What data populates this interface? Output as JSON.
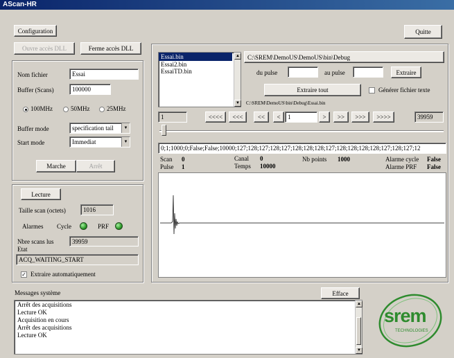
{
  "window": {
    "title": "AScan-HR"
  },
  "buttons": {
    "configuration": "Configuration",
    "quitte": "Quitte",
    "ouvre_dll": "Ouvre accès DLL",
    "ferme_dll": "Ferme accès DLL",
    "marche": "Marche",
    "arret": "Arrêt",
    "lecture": "Lecture",
    "extraire": "Extraire",
    "extraire_tout": "Extraire tout",
    "efface": "Efface",
    "nav_first": "<<<<",
    "nav_back3": "<<<",
    "nav_back2": "<<",
    "nav_back1": "<",
    "nav_fwd1": ">",
    "nav_fwd2": ">>",
    "nav_fwd3": ">>>",
    "nav_last": ">>>>"
  },
  "params": {
    "nom_fichier_label": "Nom fichier",
    "nom_fichier_value": "Essai",
    "buffer_label": "Buffer (Scans)",
    "buffer_value": "100000",
    "freq_options": [
      "100MHz",
      "50MHz",
      "25MHz"
    ],
    "freq_selected": "100MHz",
    "buffer_mode_label": "Buffer mode",
    "buffer_mode_value": "specification tail",
    "start_mode_label": "Start mode",
    "start_mode_value": "Immediat"
  },
  "lecture": {
    "taille_label": "Taille scan (octets)",
    "taille_value": "1016",
    "alarmes_label": "Alarmes",
    "cycle_label": "Cycle",
    "prf_label": "PRF",
    "nbre_label": "Nbre scans lus",
    "nbre_value": "39959",
    "etat_label": "Etat",
    "etat_value": "ACQ_WAITING_START",
    "extraire_auto_label": "Extraire automatiquement",
    "extraire_auto_checked": true
  },
  "files": {
    "list": [
      "Essai.bin",
      "Essai2.bin",
      "EssaiTD.bin"
    ],
    "selected": "Essai.bin",
    "path": "C:\\SREM\\DemoUS\\DemoUS\\bin\\Debug",
    "du_pulse_label": "du pulse",
    "au_pulse_label": "au pulse",
    "du_pulse_value": "",
    "au_pulse_value": "",
    "generer_label": "Générer fichier texte",
    "current_file": "C:\\SREM\\DemoUS\\bin\\Debug\\Essai.bin"
  },
  "nav": {
    "min_value": "1",
    "current_value": "1",
    "max_value": "39959",
    "position_fraction": 0.0
  },
  "scan": {
    "raw": "0;1;1000;0;False;False;10000;127;128;127;128;127;128;128;128;127;128;128;128;128;127;128;127;12",
    "scan_label": "Scan",
    "scan_value": "0",
    "pulse_label": "Pulse",
    "pulse_value": "1",
    "canal_label": "Canal",
    "canal_value": "0",
    "temps_label": "Temps",
    "temps_value": "10000",
    "nb_points_label": "Nb points",
    "nb_points_value": "1000",
    "alarme_cycle_label": "Alarme cycle",
    "alarme_cycle_value": "False",
    "alarme_prf_label": "Alarme PRF",
    "alarme_prf_value": "False"
  },
  "messages": {
    "title": "Messages système",
    "lines": [
      "Arrêt des acquisitions",
      "Lecture OK",
      "Acquisition en cours",
      "Arrêt des acquisitions",
      "Lecture OK"
    ]
  },
  "logo": {
    "text": "srem",
    "subtext": "TECHNOLOGIES",
    "color": "#2e8b2e"
  }
}
